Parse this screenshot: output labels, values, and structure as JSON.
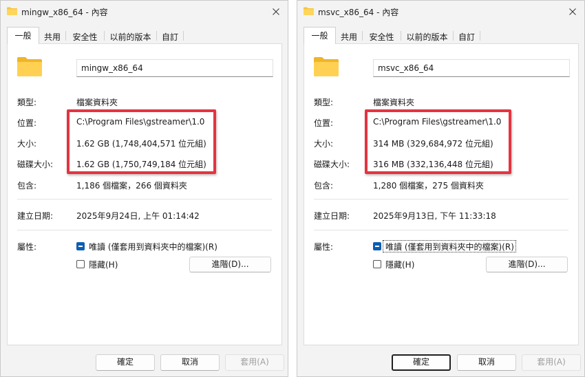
{
  "colors": {
    "highlight_box": "#e53340",
    "checkbox_accent": "#0a5fb4",
    "folder_yellow": "#f8c53a",
    "dialog_bg": "#f3f3f3"
  },
  "icons": {
    "title": "folder-icon",
    "close": "close-icon",
    "large": "folder-icon"
  },
  "dialogs": [
    {
      "title": "mingw_x86_64 - 內容",
      "tabs": [
        "一般",
        "共用",
        "安全性",
        "以前的版本",
        "自訂"
      ],
      "active_tab": 0,
      "name": "mingw_x86_64",
      "fields": [
        {
          "label": "類型:",
          "value": "檔案資料夾"
        },
        {
          "label": "位置:",
          "value": "C:\\Program Files\\gstreamer\\1.0"
        },
        {
          "label": "大小:",
          "value": "1.62 GB (1,748,404,571 位元組)"
        },
        {
          "label": "磁碟大小:",
          "value": "1.62 GB (1,750,749,184 位元組)"
        },
        {
          "label": "包含:",
          "value": "1,186 個檔案，266 個資料夾"
        }
      ],
      "created": {
        "label": "建立日期:",
        "value": "2025年9月24日, 上午 01:14:42"
      },
      "attributes": {
        "label": "屬性:",
        "readonly": {
          "label": "唯讀 (僅套用到資料夾中的檔案)(R)",
          "state": "indeterminate"
        },
        "hidden": {
          "label": "隱藏(H)",
          "checked": false
        },
        "advanced_label": "進階(D)..."
      },
      "buttons": {
        "ok": "確定",
        "cancel": "取消",
        "apply": "套用(A)"
      },
      "ok_focused": false,
      "readonly_focused": false
    },
    {
      "title": "msvc_x86_64 - 內容",
      "tabs": [
        "一般",
        "共用",
        "安全性",
        "以前的版本",
        "自訂"
      ],
      "active_tab": 0,
      "name": "msvc_x86_64",
      "fields": [
        {
          "label": "類型:",
          "value": "檔案資料夾"
        },
        {
          "label": "位置:",
          "value": "C:\\Program Files\\gstreamer\\1.0"
        },
        {
          "label": "大小:",
          "value": "314 MB (329,684,972 位元組)"
        },
        {
          "label": "磁碟大小:",
          "value": "316 MB (332,136,448 位元組)"
        },
        {
          "label": "包含:",
          "value": "1,280 個檔案，275 個資料夾"
        }
      ],
      "created": {
        "label": "建立日期:",
        "value": "2025年9月13日, 下午 11:33:18"
      },
      "attributes": {
        "label": "屬性:",
        "readonly": {
          "label": "唯讀 (僅套用到資料夾中的檔案)(R)",
          "state": "indeterminate"
        },
        "hidden": {
          "label": "隱藏(H)",
          "checked": false
        },
        "advanced_label": "進階(D)..."
      },
      "buttons": {
        "ok": "確定",
        "cancel": "取消",
        "apply": "套用(A)"
      },
      "ok_focused": true,
      "readonly_focused": true
    }
  ]
}
